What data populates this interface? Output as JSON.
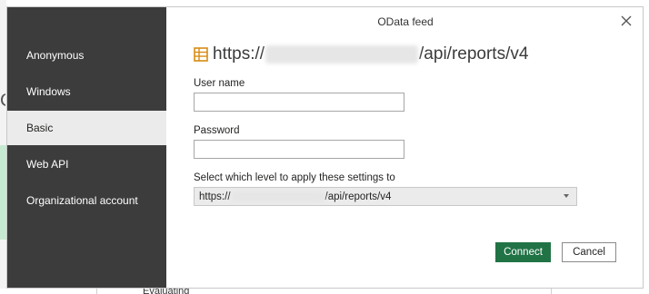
{
  "dialog": {
    "title": "OData feed",
    "close_icon": "close-icon"
  },
  "sidebar": {
    "items": [
      {
        "label": "Anonymous"
      },
      {
        "label": "Windows"
      },
      {
        "label": "Basic"
      },
      {
        "label": "Web API"
      },
      {
        "label": "Organizational account"
      }
    ],
    "active": "Basic"
  },
  "feed": {
    "icon": "table-icon",
    "url_prefix": "https://",
    "url_suffix": "/api/reports/v4"
  },
  "form": {
    "username_label": "User name",
    "username_value": "",
    "password_label": "Password",
    "password_value": "",
    "level_label": "Select which level to apply these settings to",
    "level_prefix": "https://",
    "level_suffix": "/api/reports/v4"
  },
  "buttons": {
    "connect": "Connect",
    "cancel": "Cancel"
  },
  "background": {
    "evaluating_text": "Evaluating"
  },
  "colors": {
    "sidebar": "#3c3c3c",
    "accent": "#217346",
    "active_item": "#ebebeb"
  }
}
